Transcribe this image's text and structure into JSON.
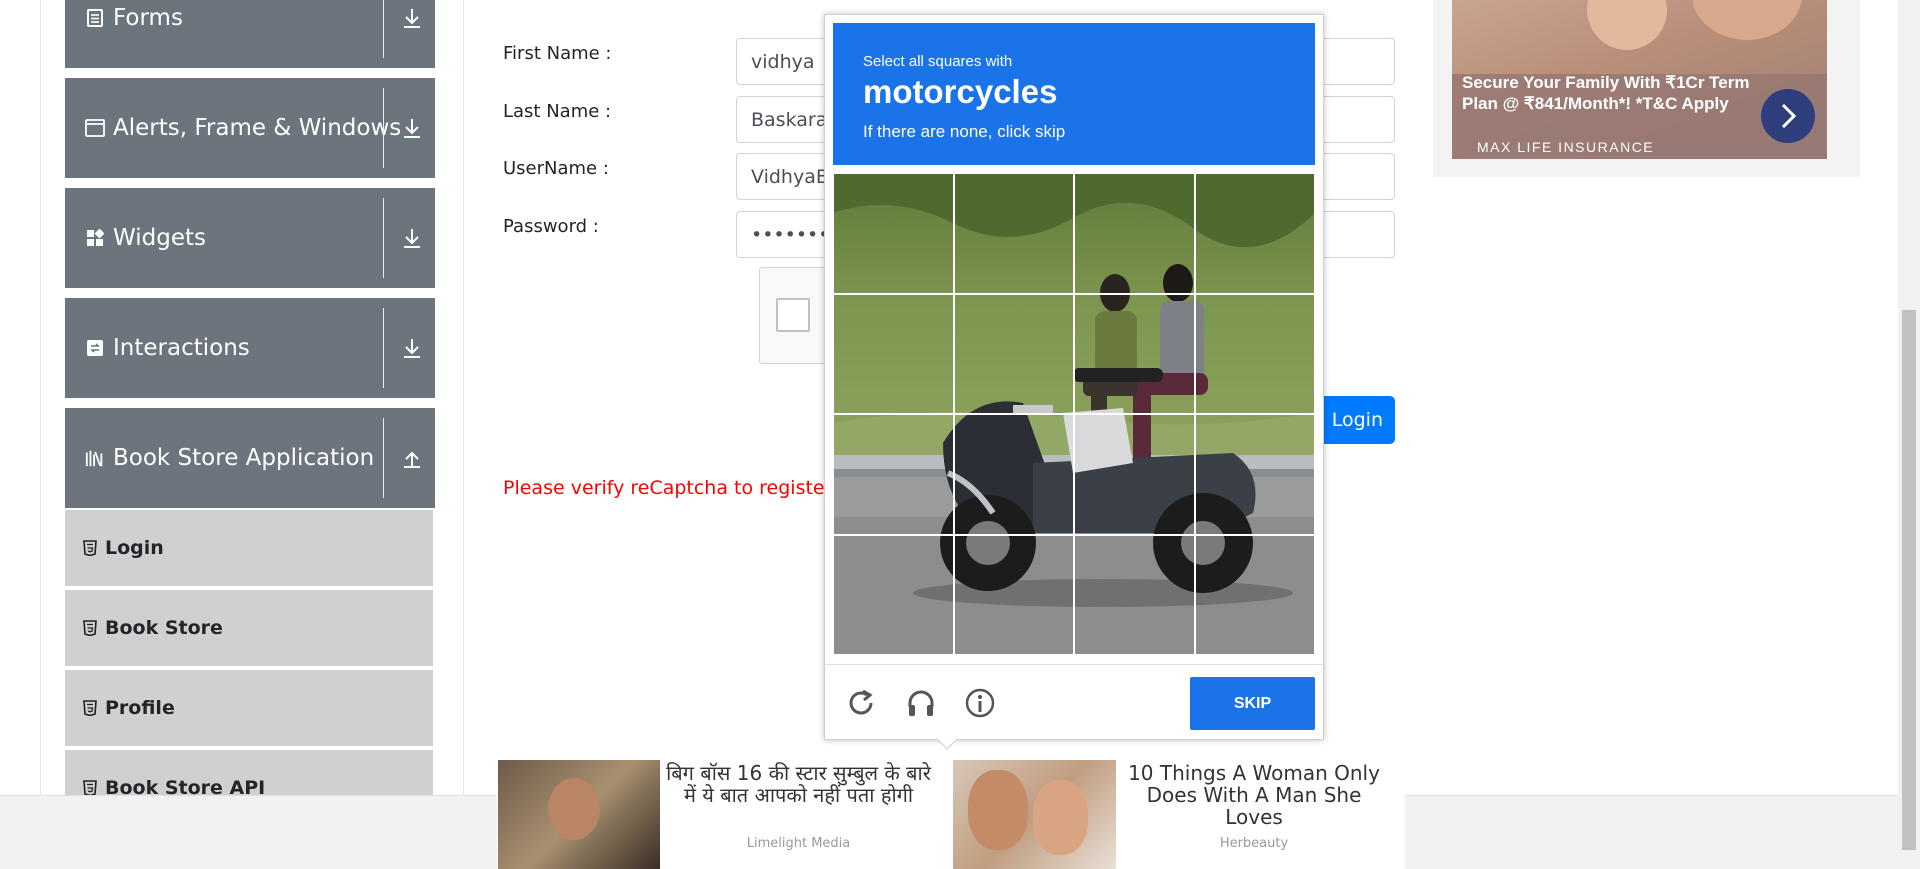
{
  "sidebar": {
    "groups": [
      {
        "title": "Forms",
        "icon": "form-icon",
        "expanded": false
      },
      {
        "title": "Alerts, Frame & Windows",
        "icon": "window-icon",
        "expanded": false
      },
      {
        "title": "Widgets",
        "icon": "widgets-icon",
        "expanded": false
      },
      {
        "title": "Interactions",
        "icon": "interactions-icon",
        "expanded": false
      },
      {
        "title": "Book Store Application",
        "icon": "books-icon",
        "expanded": true
      }
    ],
    "items": [
      {
        "label": "Login"
      },
      {
        "label": "Book Store"
      },
      {
        "label": "Profile"
      },
      {
        "label": "Book Store API"
      }
    ]
  },
  "form": {
    "first_name": {
      "label": "First Name :",
      "value": "vidhya"
    },
    "last_name": {
      "label": "Last Name :",
      "value": "Baskaran"
    },
    "username": {
      "label": "UserName :",
      "value": "VidhyaB"
    },
    "password": {
      "label": "Password :",
      "value": "••••••••••"
    },
    "login_label": "Login",
    "error": "Please verify reCaptcha to register!"
  },
  "captcha": {
    "instruction": "Select all squares with",
    "target": "motorcycles",
    "hint": "If there are none, click skip",
    "skip_label": "SKIP",
    "grid_size": 4,
    "controls": [
      "reload-icon",
      "audio-icon",
      "info-icon"
    ]
  },
  "top_ad": {
    "text": "Secure Your Family With ₹1Cr Term Plan @ ₹841/Month*! *T&C Apply",
    "brand": "MAX LIFE INSURANCE"
  },
  "bottom_ads": [
    {
      "title": "बिग बॉस 16 की स्टार सुम्बुल के बारे में ये बात आपको नहीं पता होगी",
      "source": "Limelight Media"
    },
    {
      "title": "10 Things A Woman Only Does With A Man She Loves",
      "source": "Herbeauty"
    }
  ],
  "colors": {
    "sidebar_header": "#6c757d",
    "sidebar_item": "#d0d0d0",
    "primary_button": "#007bff",
    "captcha_blue": "#1a73e8",
    "error": "#ff0000"
  }
}
